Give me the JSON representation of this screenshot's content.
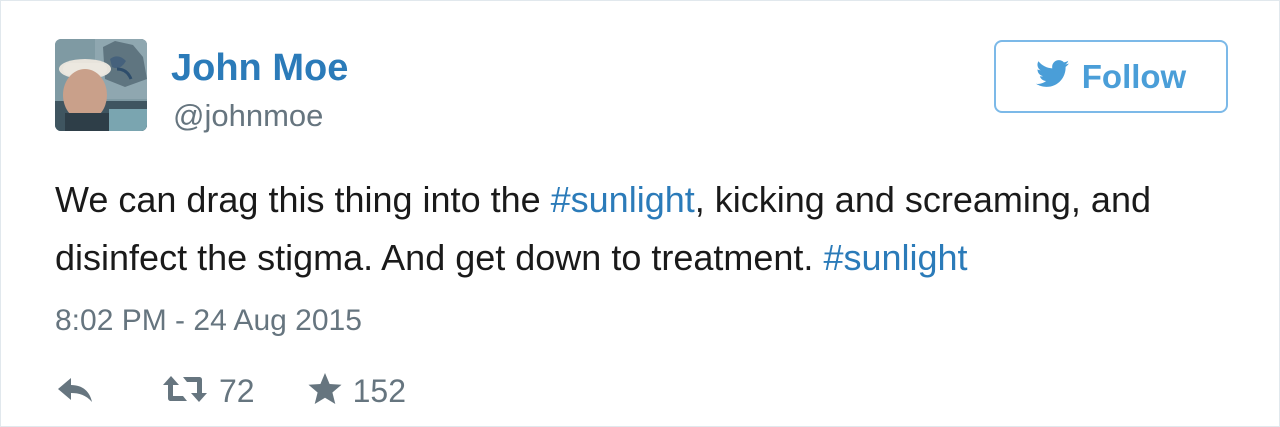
{
  "user": {
    "name": "John Moe",
    "handle": "@johnmoe"
  },
  "follow_button": {
    "label": "Follow",
    "icon": "twitter-bird-icon"
  },
  "tweet": {
    "segments": [
      "We can drag this thing into the ",
      "#sunlight",
      ", kicking and screaming, and disinfect the stigma. And get down to treatment. ",
      "#sunlight"
    ],
    "timestamp": "8:02 PM - 24 Aug 2015"
  },
  "actions": {
    "reply_icon": "reply-icon",
    "retweet_icon": "retweet-icon",
    "retweet_count": "72",
    "favorite_icon": "star-icon",
    "favorite_count": "152"
  },
  "colors": {
    "accent": "#2b7bb9",
    "muted": "#66757f",
    "button_border": "#7cb9e8"
  }
}
